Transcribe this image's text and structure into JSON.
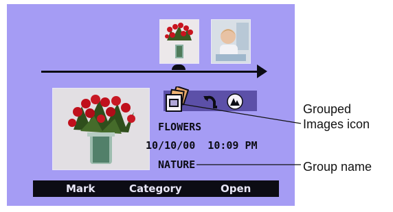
{
  "info": {
    "group_title": "FLOWERS",
    "date_time": "10/10/00  10:09 PM",
    "group_name": "NATURE"
  },
  "softkeys": {
    "mark": "Mark",
    "category": "Category",
    "open": "Open"
  },
  "callouts": {
    "grouped_images_line1": "Grouped",
    "grouped_images_line2": "Images icon",
    "group_name": "Group name"
  },
  "icons": [
    "grouped-images-icon",
    "rotate-icon",
    "enhance-icon",
    "flowers-photo",
    "child-photo"
  ],
  "colors": {
    "screen_background": "#a59cf4",
    "icon_bar": "#5c50a8",
    "softkey_bar": "#0c0c14",
    "text_dark": "#0c0c14"
  }
}
